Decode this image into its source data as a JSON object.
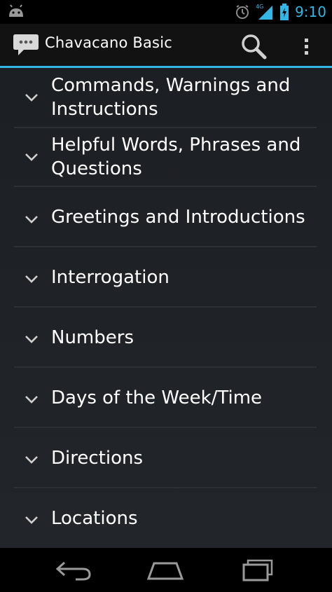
{
  "status_bar": {
    "time": "9:10",
    "network_label": "4G",
    "icons": [
      "android-icon",
      "alarm-icon",
      "signal-icon",
      "battery-icon"
    ]
  },
  "action_bar": {
    "title": "Chavacano Basic",
    "icons": [
      "chat-bubble-icon",
      "search-icon",
      "overflow-menu-icon"
    ],
    "accent_color": "#33b5e5"
  },
  "list": {
    "items": [
      {
        "label_line1": "Commands, Warnings and",
        "label_line2": "Instructions"
      },
      {
        "label_line1": "Helpful Words, Phrases and",
        "label_line2": "Questions"
      },
      {
        "label_line1": "Greetings and Introductions",
        "label_line2": ""
      },
      {
        "label_line1": "Interrogation",
        "label_line2": ""
      },
      {
        "label_line1": "Numbers",
        "label_line2": ""
      },
      {
        "label_line1": "Days of the Week/Time",
        "label_line2": ""
      },
      {
        "label_line1": "Directions",
        "label_line2": ""
      },
      {
        "label_line1": "Locations",
        "label_line2": ""
      }
    ]
  },
  "nav_bar": {
    "icons": [
      "back-icon",
      "home-icon",
      "recent-apps-icon"
    ]
  }
}
